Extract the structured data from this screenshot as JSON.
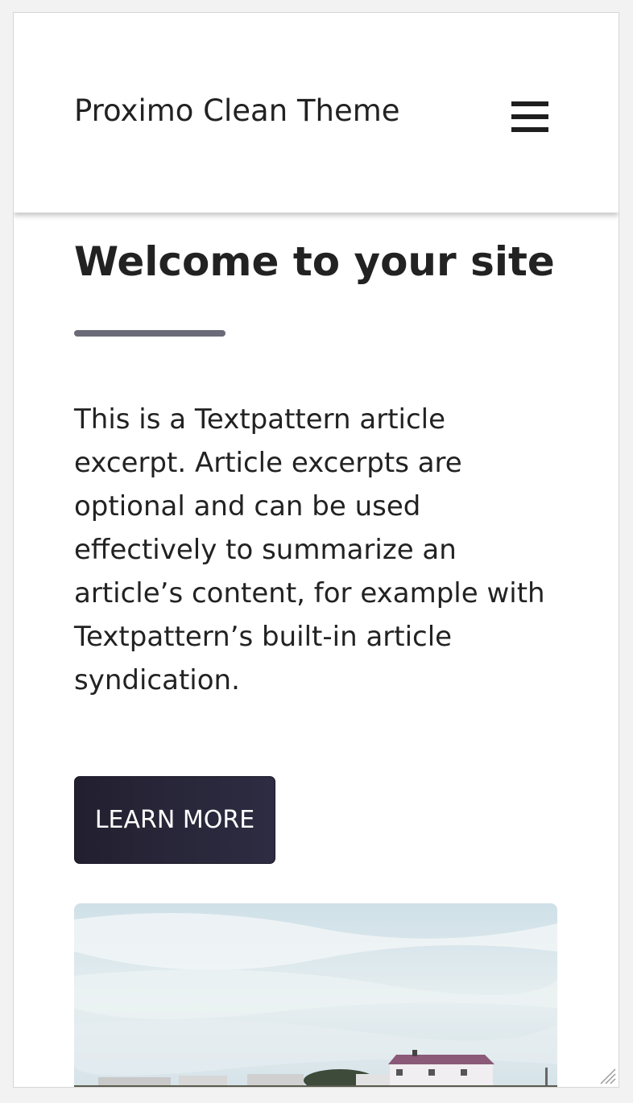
{
  "header": {
    "site_title": "Proximo Clean Theme",
    "menu_icon": "hamburger-menu-icon"
  },
  "main": {
    "title": "Welcome to your site",
    "excerpt": "This is a Textpattern article excerpt. Article excerpts are optional and can be used effectively to summarize an article’s content, for example with Textpattern’s built-in article syndication.",
    "learn_more_label": "LEARN MORE",
    "hero_image": "coastal-houses-photo"
  },
  "colors": {
    "accent": "#6a6a78",
    "button": "#2a2838",
    "text": "#222222"
  }
}
